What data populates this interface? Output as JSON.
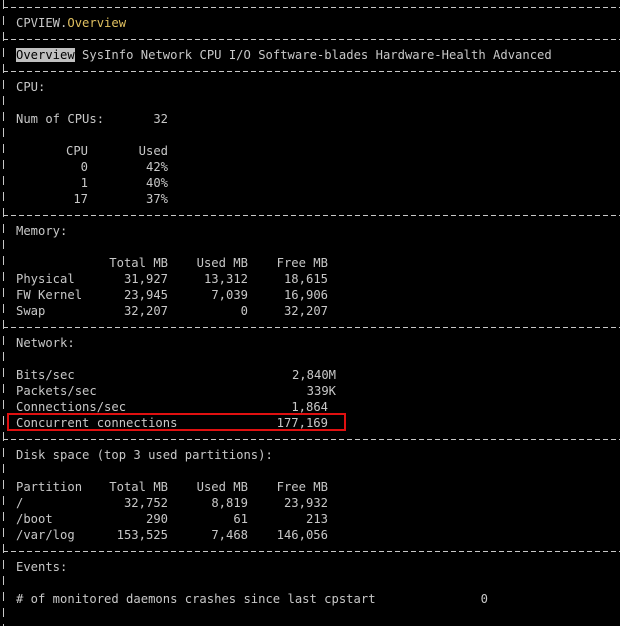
{
  "window": {
    "app": "CPVIEW",
    "separator": ".",
    "view": "Overview"
  },
  "tabs": [
    "Overview",
    "SysInfo",
    "Network",
    "CPU",
    "I/O",
    "Software-blades",
    "Hardware-Health",
    "Advanced"
  ],
  "cpu": {
    "title": "CPU:",
    "num_label": "Num of CPUs:",
    "num_value": "32",
    "headers": [
      "CPU",
      "Used"
    ],
    "rows": [
      [
        "0",
        "42%"
      ],
      [
        "1",
        "40%"
      ],
      [
        "17",
        "37%"
      ]
    ]
  },
  "memory": {
    "title": "Memory:",
    "headers": [
      "Total MB",
      "Used MB",
      "Free MB"
    ],
    "rows": [
      [
        "Physical",
        "31,927",
        "13,312",
        "18,615"
      ],
      [
        "FW Kernel",
        "23,945",
        "7,039",
        "16,906"
      ],
      [
        "Swap",
        "32,207",
        "0",
        "32,207"
      ]
    ]
  },
  "network": {
    "title": "Network:",
    "rows": [
      [
        "Bits/sec",
        "2,840M"
      ],
      [
        "Packets/sec",
        "339K"
      ],
      [
        "Connections/sec",
        "1,864"
      ],
      [
        "Concurrent connections",
        "177,169"
      ]
    ],
    "highlight_color": "#e01010"
  },
  "disk": {
    "title": "Disk space (top 3 used partitions):",
    "headers": [
      "Partition",
      "Total MB",
      "Used MB",
      "Free MB"
    ],
    "rows": [
      [
        "/",
        "32,752",
        "8,819",
        "23,932"
      ],
      [
        "/boot",
        "290",
        "61",
        "213"
      ],
      [
        "/var/log",
        "153,525",
        "7,468",
        "146,056"
      ]
    ]
  },
  "events": {
    "title": "Events:",
    "label": "# of monitored daemons crashes since last cpstart",
    "value": "0"
  },
  "colors": {
    "background": "#000000",
    "text": "#c8c8c8",
    "accent": "#e0c060",
    "selected_tab_bg": "#c0c0c0"
  }
}
